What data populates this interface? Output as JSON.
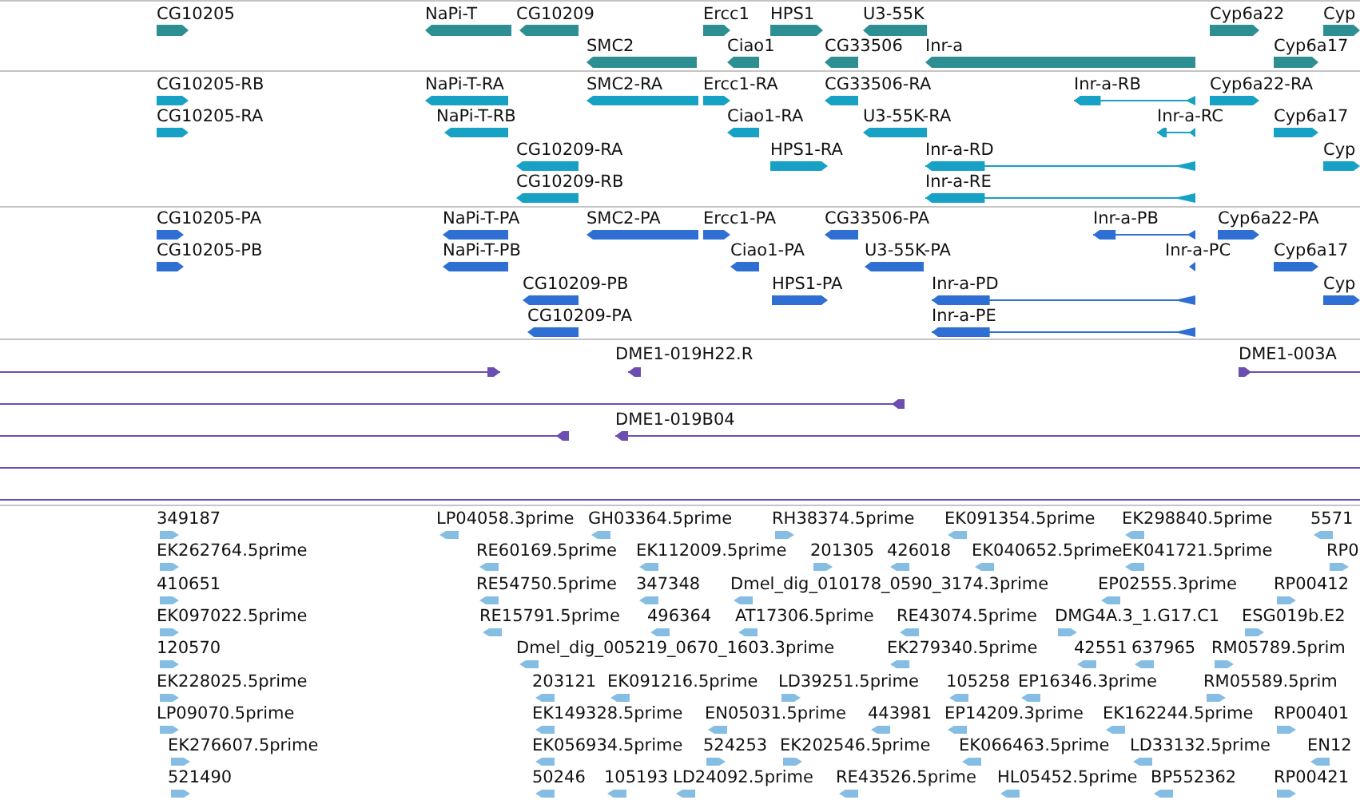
{
  "tracks": [
    {
      "kind": "gene",
      "color": "#2e8f93",
      "features": [
        {
          "label": "CG10205",
          "reverse": false
        },
        {
          "label": "NaPi-T",
          "reverse": true
        },
        {
          "label": "CG10209",
          "reverse": true
        },
        {
          "label": "Ercc1",
          "reverse": false
        },
        {
          "label": "HPS1",
          "reverse": false
        },
        {
          "label": "U3-55K",
          "reverse": true
        },
        {
          "label": "Cyp6a22",
          "reverse": false
        },
        {
          "label": "Cyp",
          "reverse": false
        },
        {
          "label": "SMC2",
          "reverse": true
        },
        {
          "label": "Ciao1",
          "reverse": true
        },
        {
          "label": "CG33506",
          "reverse": true
        },
        {
          "label": "Inr-a",
          "reverse": true
        },
        {
          "label": "Cyp6a17",
          "reverse": false
        }
      ]
    },
    {
      "kind": "transcript",
      "color": "#17a1c4",
      "features": [
        {
          "label": "CG10205-RB",
          "reverse": false
        },
        {
          "label": "NaPi-T-RA",
          "reverse": true
        },
        {
          "label": "SMC2-RA",
          "reverse": true
        },
        {
          "label": "Ercc1-RA",
          "reverse": false
        },
        {
          "label": "CG33506-RA",
          "reverse": true
        },
        {
          "label": "Inr-a-RB",
          "reverse": true
        },
        {
          "label": "Cyp6a22-RA",
          "reverse": false
        },
        {
          "label": "CG10205-RA",
          "reverse": false
        },
        {
          "label": "NaPi-T-RB",
          "reverse": true
        },
        {
          "label": "Ciao1-RA",
          "reverse": true
        },
        {
          "label": "U3-55K-RA",
          "reverse": true
        },
        {
          "label": "Inr-a-RC",
          "reverse": true
        },
        {
          "label": "Cyp6a17",
          "reverse": false
        },
        {
          "label": "CG10209-RA",
          "reverse": true
        },
        {
          "label": "HPS1-RA",
          "reverse": false
        },
        {
          "label": "Inr-a-RD",
          "reverse": true
        },
        {
          "label": "Cyp",
          "reverse": false
        },
        {
          "label": "CG10209-RB",
          "reverse": true
        },
        {
          "label": "Inr-a-RE",
          "reverse": true
        }
      ]
    },
    {
      "kind": "transcript",
      "color": "#2f6ed2",
      "features": [
        {
          "label": "CG10205-PA",
          "reverse": false
        },
        {
          "label": "NaPi-T-PA",
          "reverse": true
        },
        {
          "label": "SMC2-PA",
          "reverse": true
        },
        {
          "label": "Ercc1-PA",
          "reverse": false
        },
        {
          "label": "CG33506-PA",
          "reverse": true
        },
        {
          "label": "Inr-a-PB",
          "reverse": true
        },
        {
          "label": "Cyp6a22-PA",
          "reverse": false
        },
        {
          "label": "CG10205-PB",
          "reverse": false
        },
        {
          "label": "NaPi-T-PB",
          "reverse": true
        },
        {
          "label": "Ciao1-PA",
          "reverse": true
        },
        {
          "label": "U3-55K-PA",
          "reverse": true
        },
        {
          "label": "Inr-a-PC",
          "reverse": true
        },
        {
          "label": "Cyp6a17",
          "reverse": false
        },
        {
          "label": "CG10209-PB",
          "reverse": true
        },
        {
          "label": "HPS1-PA",
          "reverse": false
        },
        {
          "label": "Inr-a-PD",
          "reverse": true
        },
        {
          "label": "Cyp",
          "reverse": false
        },
        {
          "label": "CG10209-PA",
          "reverse": true
        },
        {
          "label": "Inr-a-PE",
          "reverse": true
        }
      ]
    },
    {
      "kind": "clone",
      "color": "#6c4db2",
      "features": [
        {
          "reverse": false,
          "headed": true
        },
        {
          "label": "DME1-019H22.R",
          "reverse": true,
          "headed": true
        },
        {
          "label": "DME1-003A",
          "reverse": false,
          "headed": true
        },
        {
          "reverse": true,
          "headed": true
        },
        {
          "label": "DME1-019B04",
          "reverse": true,
          "headed": true
        },
        {
          "reverse": true,
          "headed": true
        },
        {
          "headed": false
        },
        {
          "headed": false
        }
      ]
    },
    {
      "kind": "est",
      "color": "#86bee3",
      "features": [
        {
          "label": "349187",
          "reverse": false
        },
        {
          "label": "LP04058.3prime",
          "reverse": true
        },
        {
          "label": "GH03364.5prime",
          "reverse": true
        },
        {
          "label": "RH38374.5prime",
          "reverse": false
        },
        {
          "label": "EK091354.5prime",
          "reverse": true
        },
        {
          "label": "EK298840.5prime",
          "reverse": true
        },
        {
          "label": "5571",
          "reverse": true
        },
        {
          "label": "EK262764.5prime",
          "reverse": false
        },
        {
          "label": "RE60169.5prime",
          "reverse": true
        },
        {
          "label": "EK112009.5prime",
          "reverse": true
        },
        {
          "label": "201305",
          "reverse": false
        },
        {
          "label": "426018",
          "reverse": true
        },
        {
          "label": "EK040652.5prime",
          "reverse": true
        },
        {
          "label": "EK041721.5prime",
          "reverse": true
        },
        {
          "label": "RP0",
          "reverse": false
        },
        {
          "label": "410651",
          "reverse": false
        },
        {
          "label": "RE54750.5prime",
          "reverse": true
        },
        {
          "label": "347348",
          "reverse": true
        },
        {
          "label": "Dmel_dig_010178_0590_3174.3prime",
          "reverse": true
        },
        {
          "label": "EP02555.3prime",
          "reverse": true
        },
        {
          "label": "RP00412",
          "reverse": false
        },
        {
          "label": "EK097022.5prime",
          "reverse": false
        },
        {
          "label": "RE15791.5prime",
          "reverse": true
        },
        {
          "label": "496364",
          "reverse": true
        },
        {
          "label": "AT17306.5prime",
          "reverse": true
        },
        {
          "label": "RE43074.5prime",
          "reverse": true
        },
        {
          "label": "DMG4A.3_1.G17.C1",
          "reverse": false
        },
        {
          "label": "ESG019b.E2",
          "reverse": false
        },
        {
          "label": "120570",
          "reverse": false
        },
        {
          "label": "Dmel_dig_005219_0670_1603.3prime",
          "reverse": true
        },
        {
          "label": "EK279340.5prime",
          "reverse": true
        },
        {
          "label": "42551",
          "reverse": true
        },
        {
          "label": "637965",
          "reverse": true
        },
        {
          "label": "RM05789.5prim",
          "reverse": false
        },
        {
          "label": "EK228025.5prime",
          "reverse": false
        },
        {
          "label": "203121",
          "reverse": true
        },
        {
          "label": "EK091216.5prime",
          "reverse": true
        },
        {
          "label": "LD39251.5prime",
          "reverse": false
        },
        {
          "label": "105258",
          "reverse": true
        },
        {
          "label": "EP16346.3prime",
          "reverse": true
        },
        {
          "label": "RM05589.5prim",
          "reverse": false
        },
        {
          "label": "LP09070.5prime",
          "reverse": false
        },
        {
          "label": "EK149328.5prime",
          "reverse": true
        },
        {
          "label": "EN05031.5prime",
          "reverse": true
        },
        {
          "label": "443981",
          "reverse": true
        },
        {
          "label": "EP14209.3prime",
          "reverse": true
        },
        {
          "label": "EK162244.5prime",
          "reverse": true
        },
        {
          "label": "RP00401",
          "reverse": false
        },
        {
          "label": "EK276607.5prime",
          "reverse": false
        },
        {
          "label": "EK056934.5prime",
          "reverse": true
        },
        {
          "label": "524253",
          "reverse": false
        },
        {
          "label": "EK202546.5prime",
          "reverse": false
        },
        {
          "label": "EK066463.5prime",
          "reverse": true
        },
        {
          "label": "LD33132.5prime",
          "reverse": true
        },
        {
          "label": "EN12",
          "reverse": true
        },
        {
          "label": "521490",
          "reverse": false
        },
        {
          "label": "50246",
          "reverse": true
        },
        {
          "label": "105193",
          "reverse": true
        },
        {
          "label": "LD24092.5prime",
          "reverse": true
        },
        {
          "label": "RE43526.5prime",
          "reverse": true
        },
        {
          "label": "HL05452.5prime",
          "reverse": true
        },
        {
          "label": "BP552362",
          "reverse": true
        },
        {
          "label": "RP00421",
          "reverse": false
        }
      ]
    }
  ]
}
